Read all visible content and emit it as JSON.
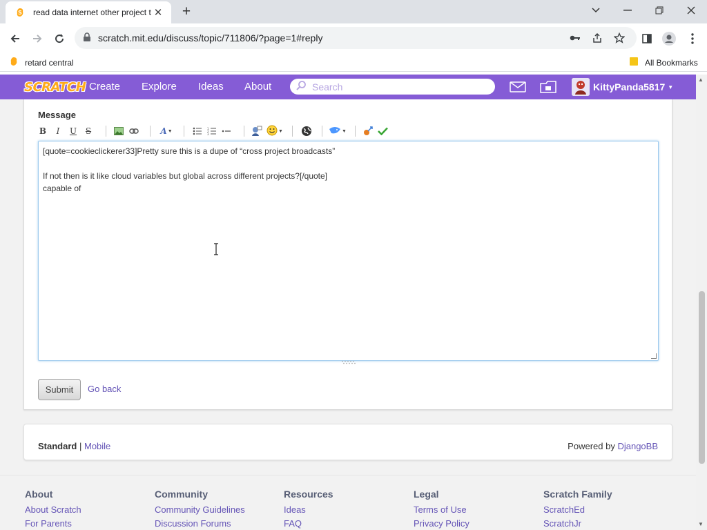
{
  "browser": {
    "tab_title": "read data internet other project t",
    "url": "scratch.mit.edu/discuss/topic/711806/?page=1#reply",
    "bookmarks": [
      {
        "label": "retard central"
      },
      {
        "label": "All Bookmarks"
      }
    ]
  },
  "site_nav": {
    "logo": "SCRATCH",
    "links": [
      "Create",
      "Explore",
      "Ideas",
      "About"
    ],
    "search_placeholder": "Search",
    "username": "KittyPanda5817",
    "accent_color": "#855cd6"
  },
  "reply_form": {
    "label": "Message",
    "toolbar": {
      "bold": "B",
      "italic": "I",
      "underline": "U",
      "strike": "S",
      "color_letter": "A"
    },
    "editor_lines": [
      "[quote=cookieclickerer33]Pretty sure this is a dupe of “cross project broadcasts”",
      "",
      "If not then is it like cloud variables but global across different projects?[/quote]",
      "capable of"
    ],
    "submit_label": "Submit",
    "go_back_label": "Go back"
  },
  "forum_footer": {
    "standard": "Standard",
    "separator": "|",
    "mobile": "Mobile",
    "powered_by": "Powered by",
    "powered_link": "DjangoBB"
  },
  "site_footer": {
    "columns": [
      {
        "heading": "About",
        "links": [
          "About Scratch",
          "For Parents"
        ]
      },
      {
        "heading": "Community",
        "links": [
          "Community Guidelines",
          "Discussion Forums"
        ]
      },
      {
        "heading": "Resources",
        "links": [
          "Ideas",
          "FAQ"
        ]
      },
      {
        "heading": "Legal",
        "links": [
          "Terms of Use",
          "Privacy Policy"
        ]
      },
      {
        "heading": "Scratch Family",
        "links": [
          "ScratchEd",
          "ScratchJr"
        ]
      }
    ]
  }
}
